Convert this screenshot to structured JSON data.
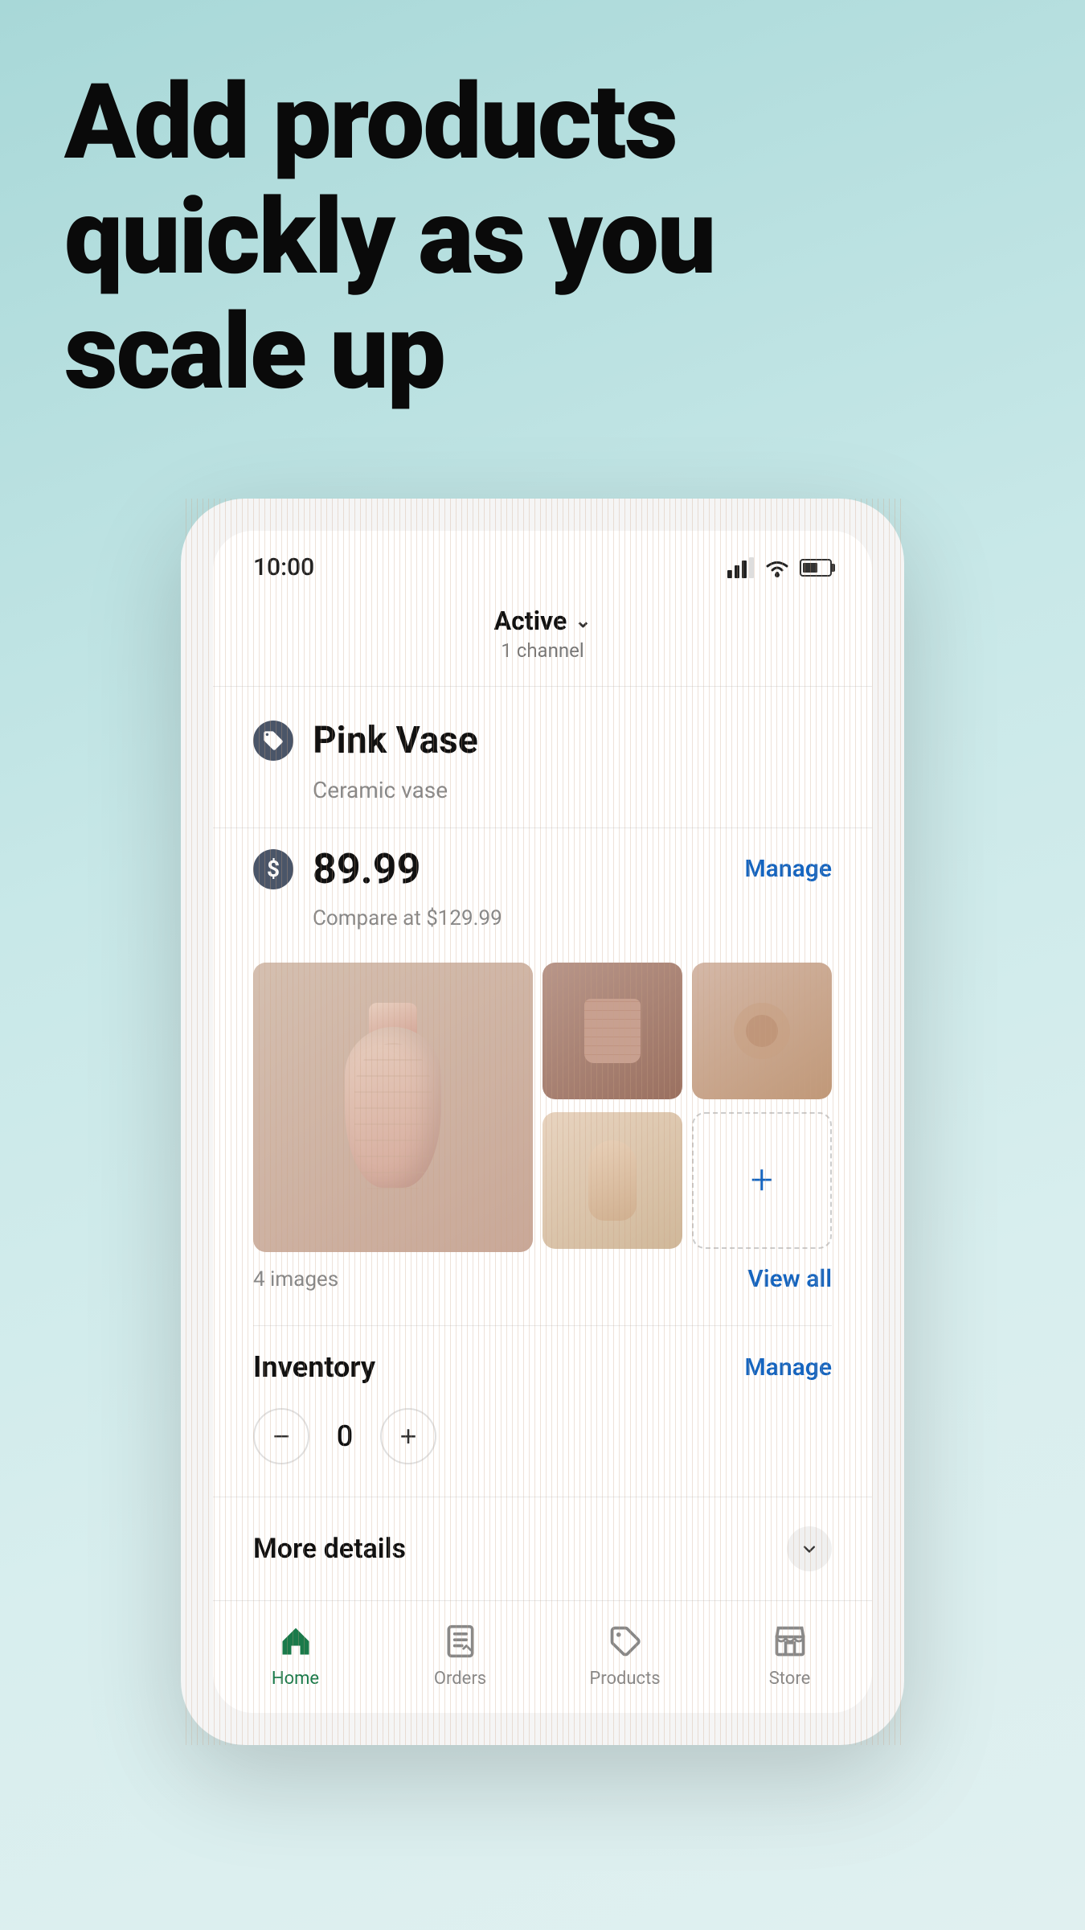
{
  "headline": {
    "line1": "Add products",
    "line2": "quickly as you",
    "line3": "scale up"
  },
  "statusBar": {
    "time": "10:00"
  },
  "activeHeader": {
    "status": "Active",
    "channelCount": "1 channel"
  },
  "product": {
    "name": "Pink Vase",
    "description": "Ceramic vase",
    "price": "89.99",
    "compareAt": "Compare at $129.99",
    "manageLabel": "Manage",
    "imageCount": "4 images",
    "viewAllLabel": "View all"
  },
  "inventory": {
    "title": "Inventory",
    "manageLabel": "Manage",
    "quantity": "0",
    "decrementLabel": "−",
    "incrementLabel": "+"
  },
  "moreDetails": {
    "label": "More details"
  },
  "nav": {
    "items": [
      {
        "label": "Home",
        "active": true
      },
      {
        "label": "Orders",
        "active": false
      },
      {
        "label": "Products",
        "active": false
      },
      {
        "label": "Store",
        "active": false
      }
    ]
  }
}
